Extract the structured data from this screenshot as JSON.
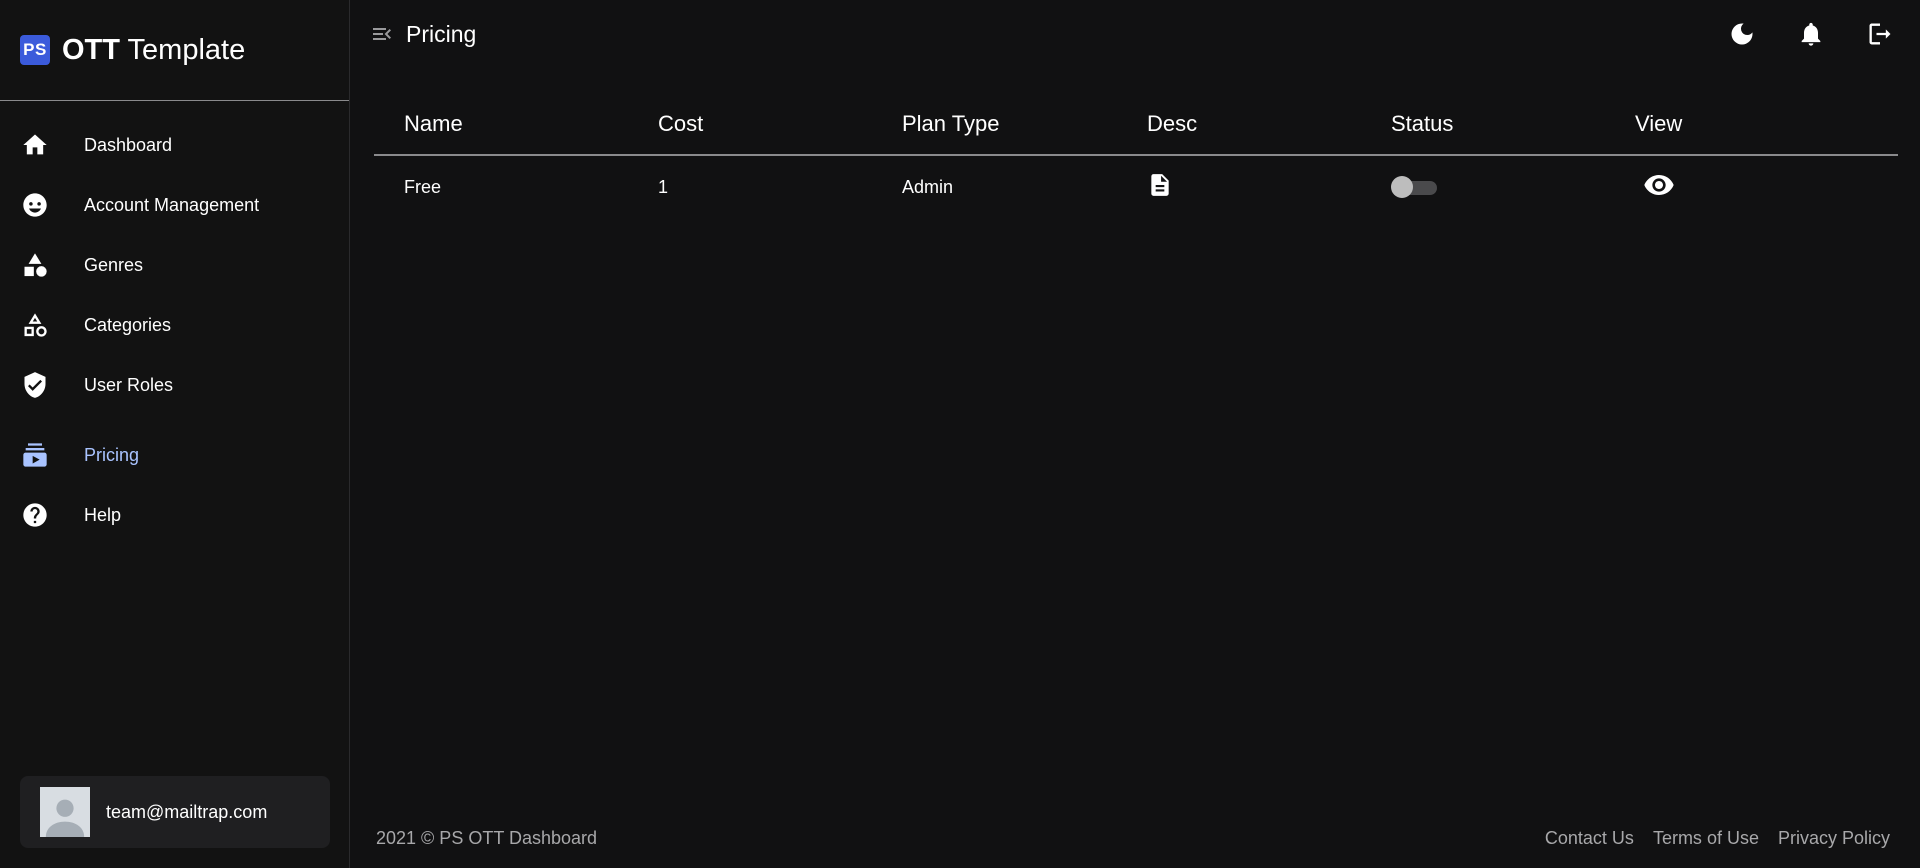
{
  "brand": {
    "logo_text": "PS",
    "title_bold": "OTT",
    "title_rest": " Template"
  },
  "sidebar": {
    "items": [
      {
        "label": "Dashboard",
        "icon": "home-icon"
      },
      {
        "label": "Account Management",
        "icon": "face-icon"
      },
      {
        "label": "Genres",
        "icon": "shapes-icon"
      },
      {
        "label": "Categories",
        "icon": "category-shapes-icon"
      },
      {
        "label": "User Roles",
        "icon": "shield-check-icon"
      },
      {
        "label": "Pricing",
        "icon": "subscriptions-icon",
        "active": true
      },
      {
        "label": "Help",
        "icon": "help-circle-icon"
      }
    ],
    "user_email": "team@mailtrap.com"
  },
  "header": {
    "title": "Pricing",
    "actions": [
      "dark-mode-icon",
      "notifications-icon",
      "logout-icon"
    ]
  },
  "table": {
    "columns": [
      "Name",
      "Cost",
      "Plan Type",
      "Desc",
      "Status",
      "View"
    ],
    "rows": [
      {
        "name": "Free",
        "cost": "1",
        "plan_type": "Admin",
        "desc_icon": "document-icon",
        "status_on": false,
        "view_icon": "eye-icon"
      }
    ]
  },
  "footer": {
    "copyright": "2021 © PS OTT Dashboard",
    "links": [
      "Contact Us",
      "Terms of Use",
      "Privacy Policy"
    ]
  },
  "colors": {
    "background": "#111112",
    "active": "#a9c3ff",
    "brand": "#3b5bdb"
  }
}
